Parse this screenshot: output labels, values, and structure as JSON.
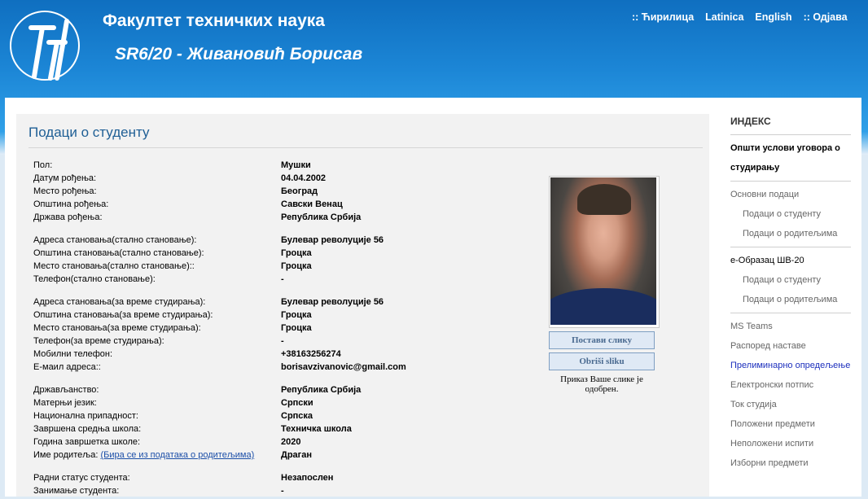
{
  "header": {
    "faculty_name": "Факултет техничких наука",
    "student_title": "SR6/20 - Живановић Борисав",
    "logo_text": "ФАКУЛТЕТ ТЕХНИЧКИХ НАУКА НОВИ САД",
    "languages": [
      ":: Ћирилица",
      "Latinica",
      "English",
      ":: Одјава"
    ]
  },
  "panel": {
    "title": "Подаци о студенту",
    "groups": [
      [
        {
          "label": "Пол:",
          "value": "Мушки"
        },
        {
          "label": "Датум рођења:",
          "value": "04.04.2002"
        },
        {
          "label": "Место рођења:",
          "value": "Београд"
        },
        {
          "label": "Општина рођења:",
          "value": "Савски Венац"
        },
        {
          "label": "Држава рођења:",
          "value": "Република Србија"
        }
      ],
      [
        {
          "label": "Адреса становања(стално становање):",
          "value": "Булевар револуције 56"
        },
        {
          "label": "Општина становања(стално становање):",
          "value": "Гроцка"
        },
        {
          "label": "Место становања(стално становање)::",
          "value": "Гроцка"
        },
        {
          "label": "Телефон(стално становање):",
          "value": "-"
        }
      ],
      [
        {
          "label": "Адреса становања(за време студирања):",
          "value": "Булевар револуције 56"
        },
        {
          "label": "Општина становања(за време студирања):",
          "value": "Гроцка"
        },
        {
          "label": "Место становања(за време студирања):",
          "value": "Гроцка"
        },
        {
          "label": "Телефон(за време студирања):",
          "value": "-"
        },
        {
          "label": "Мобилни телефон:",
          "value": "+38163256274"
        },
        {
          "label": "Е-маил адреса::",
          "value": "borisavzivanovic@gmail.com"
        }
      ],
      [
        {
          "label": "Држављанство:",
          "value": "Република Србија"
        },
        {
          "label": "Матерњи језик:",
          "value": "Српски"
        },
        {
          "label": "Национална припадност:",
          "value": "Српска"
        },
        {
          "label": "Завршена средња школа:",
          "value": "Техничка школа"
        },
        {
          "label": "Година завршетка школе:",
          "value": "2020"
        },
        {
          "label": "Име родитеља:",
          "link": "(Бира се из података о родитељима)",
          "value": "Драган"
        }
      ],
      [
        {
          "label": "Радни статус студента:",
          "value": "Незапослен"
        },
        {
          "label": "Занимање студента:",
          "value": "-"
        }
      ]
    ],
    "photo_buttons": {
      "set": "Постави слику",
      "delete": "Obriši sliku"
    },
    "photo_note": "Приказ Ваше слике је одобрен."
  },
  "sidebar": {
    "heading": "ИНДЕКС",
    "items": [
      {
        "label": "Општи услови уговора о студирању",
        "style": "bold",
        "rule_after": true
      },
      {
        "label": "Основни подаци",
        "style": "normal"
      },
      {
        "label": "Подаци о студенту",
        "style": "sub"
      },
      {
        "label": "Подаци о родитељима",
        "style": "sub",
        "rule_after": true
      },
      {
        "label": "е-Образац ШВ-20",
        "style": "dark"
      },
      {
        "label": "Подаци о студенту",
        "style": "sub"
      },
      {
        "label": "Подаци о родитељима",
        "style": "sub",
        "rule_after": true
      },
      {
        "label": "MS Teams",
        "style": "normal"
      },
      {
        "label": "Распоред наставе",
        "style": "normal"
      },
      {
        "label": "Прелиминарно опредељење",
        "style": "link"
      },
      {
        "label": "Електронски потпис",
        "style": "normal"
      },
      {
        "label": "Ток студија",
        "style": "normal"
      },
      {
        "label": "Положени предмети",
        "style": "normal"
      },
      {
        "label": "Неположени испити",
        "style": "normal"
      },
      {
        "label": "Изборни предмети",
        "style": "normal"
      }
    ]
  },
  "colors": {
    "header_blue": "#1c86d6",
    "title_blue": "#1f5f95",
    "link_blue": "#1c2fbd"
  }
}
